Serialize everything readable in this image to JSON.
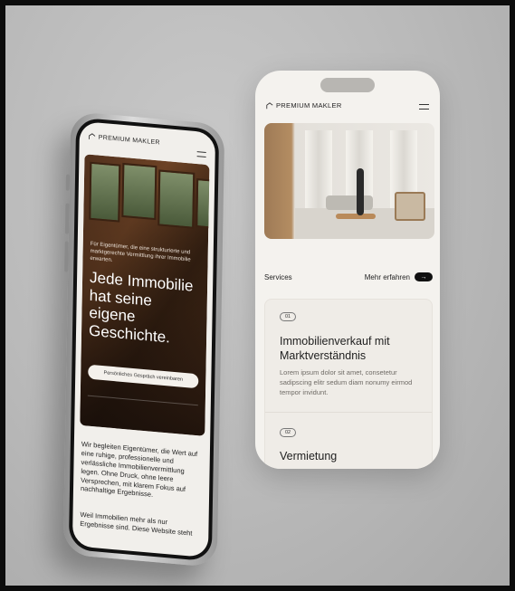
{
  "left_phone": {
    "logo_text": "PREMIUM MAKLER",
    "hero_subtitle": "Für Eigentümer, die eine strukturierte und marktgerechte Vermittlung ihrer Immobilie erwarten.",
    "hero_title": "Jede Immobilie hat seine eigene Geschichte.",
    "cta_label": "Persönliches Gespräch vereinbaren",
    "body_paragraph_1": "Wir begleiten Eigentümer, die Wert auf eine ruhige, professionelle und verlässliche Immobilienvermittlung legen. Ohne Druck, ohne leere Versprechen, mit klarem Fokus auf nachhaltige Ergebnisse.",
    "body_paragraph_2": "Weil Immobilien mehr als nur Ergebnisse sind. Diese Website steht"
  },
  "right_phone": {
    "logo_text": "PREMIUM MAKLER",
    "services_label": "Services",
    "more_label": "Mehr erfahren",
    "more_arrow": "→",
    "services": [
      {
        "number": "01",
        "title": "Immobilienverkauf mit Marktverständnis",
        "description": "Lorem ipsum dolor sit amet, consetetur sadipscing elitr sedum diam nonumy eirmod tempor invidunt."
      },
      {
        "number": "02",
        "title": "Vermietung"
      }
    ]
  },
  "colors": {
    "background": "#bdbdbd",
    "screen": "#f1efeb",
    "accent_dark": "#111111"
  }
}
